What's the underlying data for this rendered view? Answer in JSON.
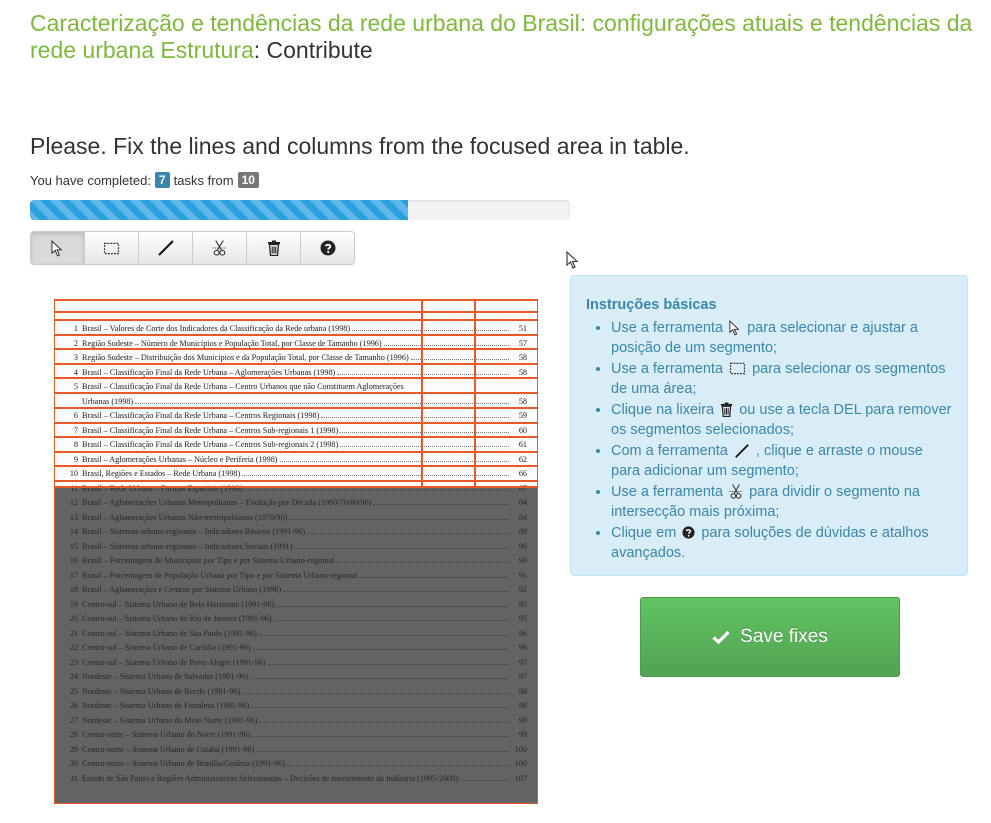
{
  "header": {
    "title_link": "Caracterização e tendências da rede urbana do Brasil: configurações atuais e tendências da rede urbana Estrutura",
    "title_suffix": ": Contribute"
  },
  "prompt": "Please. Fix the lines and columns from the focused area in table.",
  "progress": {
    "label_before": "You have completed:",
    "completed": "7",
    "label_middle": "tasks from",
    "total": "10",
    "fraction": 0.7
  },
  "toolbar": {
    "tools": [
      {
        "name": "select-tool",
        "icon": "pointer-icon"
      },
      {
        "name": "area-tool",
        "icon": "rectangle-icon"
      },
      {
        "name": "line-tool",
        "icon": "line-icon"
      },
      {
        "name": "scissors-tool",
        "icon": "scissors-icon"
      },
      {
        "name": "delete-tool",
        "icon": "trash-icon"
      },
      {
        "name": "help-tool",
        "icon": "question-icon"
      }
    ]
  },
  "instructions": {
    "heading": "Instruções básicas",
    "items": [
      {
        "before": "Use a ferramenta",
        "icon": "pointer-icon",
        "after": "para selecionar e ajustar a posição de um segmento;"
      },
      {
        "before": "Use a ferramenta",
        "icon": "rectangle-icon",
        "after": "para selecionar os segmentos de uma área;"
      },
      {
        "before": "Clique na lixeira",
        "icon": "trash-icon",
        "after": "ou use a tecla DEL para remover os segmentos selecionados;"
      },
      {
        "before": "Com a ferramenta",
        "icon": "line-icon",
        "after": ", clique e arraste o mouse para adicionar um segmento;"
      },
      {
        "before": "Use a ferramenta",
        "icon": "scissors-icon",
        "after": "para dividir o segmento na intersecção mais próxima;"
      },
      {
        "before": "Clique em",
        "icon": "question-icon",
        "after": "para soluções de dúvidas e atalhos avançados."
      }
    ]
  },
  "save_button": {
    "label": "Save fixes",
    "icon": "check-icon"
  },
  "document": {
    "rows": [
      {
        "n": "1",
        "text": "Brasil – Valores de Corte dos Indicadores da Classificação da Rede urbana (1998)",
        "page": "51"
      },
      {
        "n": "2",
        "text": "Região Sudeste – Número de Municípios e População Total, por Classe de Tamanho (1996)",
        "page": "57"
      },
      {
        "n": "3",
        "text": "Região Sudeste – Distribuição dos Municípios e da População Total, por Classe de Tamanho (1996)",
        "page": "58"
      },
      {
        "n": "4",
        "text": "Brasil – Classificação Final da Rede Urbana – Aglomerações Urbanas (1998)",
        "page": "58"
      },
      {
        "n": "5",
        "text": "Brasil – Classificação Final da Rede Urbana – Centro Urbanos que não Constituem Aglomerações",
        "page": ""
      },
      {
        "n": "",
        "text": "Urbanas (1998)",
        "page": "58"
      },
      {
        "n": "6",
        "text": "Brasil – Classificação Final da Rede Urbana – Centros Regionais (1998)",
        "page": "59"
      },
      {
        "n": "7",
        "text": "Brasil – Classificação Final da Rede Urbana – Centros Sub-regionais 1 (1998)",
        "page": "60"
      },
      {
        "n": "8",
        "text": "Brasil – Classificação Final da Rede Urbana – Centros Sub-regionais 2 (1998)",
        "page": "61"
      },
      {
        "n": "9",
        "text": "Brasil – Aglomerações Urbanas – Núcleo e Periferia (1998)",
        "page": "62"
      },
      {
        "n": "10",
        "text": "Brasil, Regiões e Estados – Rede Urbana (1998)",
        "page": "66"
      },
      {
        "n": "11",
        "text": "Brasil – Rede Urbana – Formas Espaciais (1998)",
        "page": "67"
      },
      {
        "n": "12",
        "text": "Brasil – Aglomerações Urbanas Metropolitanas – Evolução por Década (1960/70/80/90)",
        "page": "84"
      },
      {
        "n": "13",
        "text": "Brasil – Aglomerações Urbanas Não-metropolitanas (1970/90)",
        "page": "84"
      },
      {
        "n": "14",
        "text": "Brasil – Sistemas urbano-regionais – Indicadores Básicos (1991-96)",
        "page": "89"
      },
      {
        "n": "15",
        "text": "Brasil – Sistemas urbano-regionais – Indicadores Sociais (1991)",
        "page": "90"
      },
      {
        "n": "16",
        "text": "Brasil – Porcentagem de Municípios por Tipo e por Sistema Urbano-regional",
        "page": "90"
      },
      {
        "n": "17",
        "text": "Brasil – Porcentagem de População Urbana por Tipo e por Sistema Urbano-regional",
        "page": "91"
      },
      {
        "n": "18",
        "text": "Brasil – Aglomerações e Centros por Sistema Urbano (1996)",
        "page": "92"
      },
      {
        "n": "19",
        "text": "Centro-sul – Sistema Urbano de Belo Horizonte (1991-96)",
        "page": "95"
      },
      {
        "n": "20",
        "text": "Centro-sul – Sistema Urbano do Rio de Janeiro (1991-96)",
        "page": "95"
      },
      {
        "n": "21",
        "text": "Centro-sul – Sistema Urbano de São Paulo (1991-96)",
        "page": "96"
      },
      {
        "n": "22",
        "text": "Centro-sul – Sistema Urbano de Curitiba (1991-96)",
        "page": "96"
      },
      {
        "n": "23",
        "text": "Centro-sul – Sistema Urbano de Porto Alegre (1991-96)",
        "page": "97"
      },
      {
        "n": "24",
        "text": "Nordeste – Sistema Urbano de Salvador (1991-96)",
        "page": "97"
      },
      {
        "n": "25",
        "text": "Nordeste – Sistema Urbano de Recife (1991-96)",
        "page": "98"
      },
      {
        "n": "26",
        "text": "Nordeste – Sistema Urbano de Fortaleza (1991-96)",
        "page": "98"
      },
      {
        "n": "27",
        "text": "Nordeste – Sistema Urbano do Meio Norte (1991-96)",
        "page": "99"
      },
      {
        "n": "28",
        "text": "Centro-norte – Sistema Urbano do Norte (1991-96)",
        "page": "99"
      },
      {
        "n": "29",
        "text": "Centro-norte – Sistema Urbano de Cuiabá (1991-96)",
        "page": "100"
      },
      {
        "n": "30",
        "text": "Centro-norte – Sistema Urbano de Brasília/Goiânia (1991-96)",
        "page": "100"
      },
      {
        "n": "31",
        "text": "Estado de São Paulo e Regiões Administrativas Selecionadas – Decisões de Investimento da Indústria (1995-2000)",
        "page": "107"
      }
    ]
  }
}
